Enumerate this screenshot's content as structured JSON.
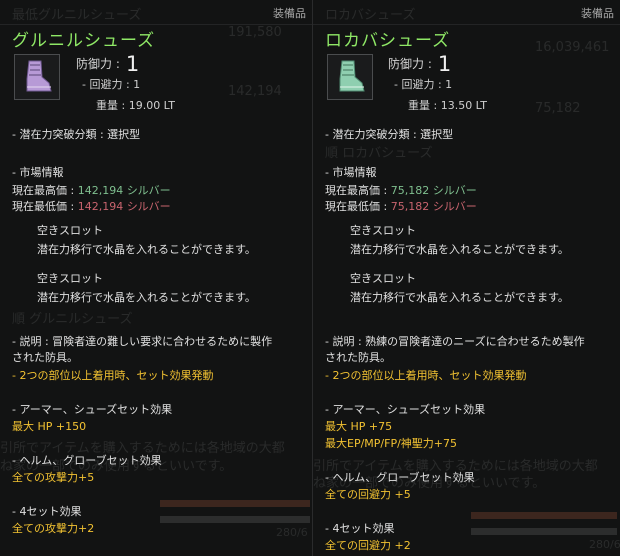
{
  "left": {
    "category": "装備品",
    "name": "グルニルシューズ",
    "defense_label": "防御力 :",
    "defense_value": "1",
    "evasion": "- 回避力 : 1",
    "weight": "重量 : 19.00 LT",
    "potential_break": "- 潜在力突破分類 : 選択型",
    "market_title": "- 市場情報",
    "max_price_label": "現在最高価 :",
    "max_price_value": "142,194 シルバー",
    "min_price_label": "現在最低価 :",
    "min_price_value": "142,194 シルバー",
    "slot1_title": "空きスロット",
    "slot1_text": "潜在力移行で水晶を入れることができます。",
    "slot2_title": "空きスロット",
    "slot2_text": "潜在力移行で水晶を入れることができます。",
    "desc_line1": "- 説明 : 冒険者達の難しい要求に合わせるために製作",
    "desc_line2": "された防具。",
    "set_notice": "- 2つの部位以上着用時、セット効果発動",
    "set1_title": "- アーマー、シューズセット効果",
    "set1_effect1": "最大 HP +150",
    "set2_title": "- ヘルム、グローブセット効果",
    "set2_effect1": "全ての攻撃力+5",
    "set3_title": "- 4セット効果",
    "set3_effect1": "全ての攻撃力+2",
    "bg_numbers": [
      "191,580",
      "142,194",
      "280/6"
    ],
    "bg_texts": [
      "最低グルニルシューズ",
      "順 グルニルシューズ",
      "引所でアイテムを購入するためには各地域の大都",
      "ね家の一部でのみ使用するといいです。"
    ]
  },
  "right": {
    "category": "装備品",
    "name": "ロカバシューズ",
    "defense_label": "防御力 :",
    "defense_value": "1",
    "evasion": "- 回避力 : 1",
    "weight": "重量 : 13.50 LT",
    "potential_break": "- 潜在力突破分類 : 選択型",
    "market_title": "- 市場情報",
    "max_price_label": "現在最高価 :",
    "max_price_value": "75,182 シルバー",
    "min_price_label": "現在最低価 :",
    "min_price_value": "75,182 シルバー",
    "slot1_title": "空きスロット",
    "slot1_text": "潜在力移行で水晶を入れることができます。",
    "slot2_title": "空きスロット",
    "slot2_text": "潜在力移行で水晶を入れることができます。",
    "desc_line1": "- 説明 : 熟練の冒険者達のニーズに合わせるため製作",
    "desc_line2": "された防具。",
    "set_notice": "- 2つの部位以上着用時、セット効果発動",
    "set1_title": "- アーマー、シューズセット効果",
    "set1_effect1": "最大 HP +75",
    "set1_effect2": "最大EP/MP/FP/神聖力+75",
    "set2_title": "- ヘルム、グローブセット効果",
    "set2_effect1": "全ての回避力 +5",
    "set3_title": "- 4セット効果",
    "set3_effect1": "全ての回避力 +2",
    "bg_numbers": [
      "16,039,461",
      "75,182",
      "280/6"
    ],
    "bg_texts": [
      "ロカバシューズ",
      "順 ロカバシューズ",
      "引所でアイテムを購入するためには各地域の大都",
      "ね家の一部でのみ使用するといいです。"
    ]
  },
  "colors": {
    "item_name": "#8fe866",
    "price_max": "#7fbf8f",
    "price_min": "#c8646e",
    "set_effect": "#f2c232",
    "left_icon": "#b79ad6",
    "right_icon": "#8fcfb0"
  },
  "icons": {
    "left_item": "purple-boot-icon",
    "right_item": "teal-boot-icon"
  }
}
